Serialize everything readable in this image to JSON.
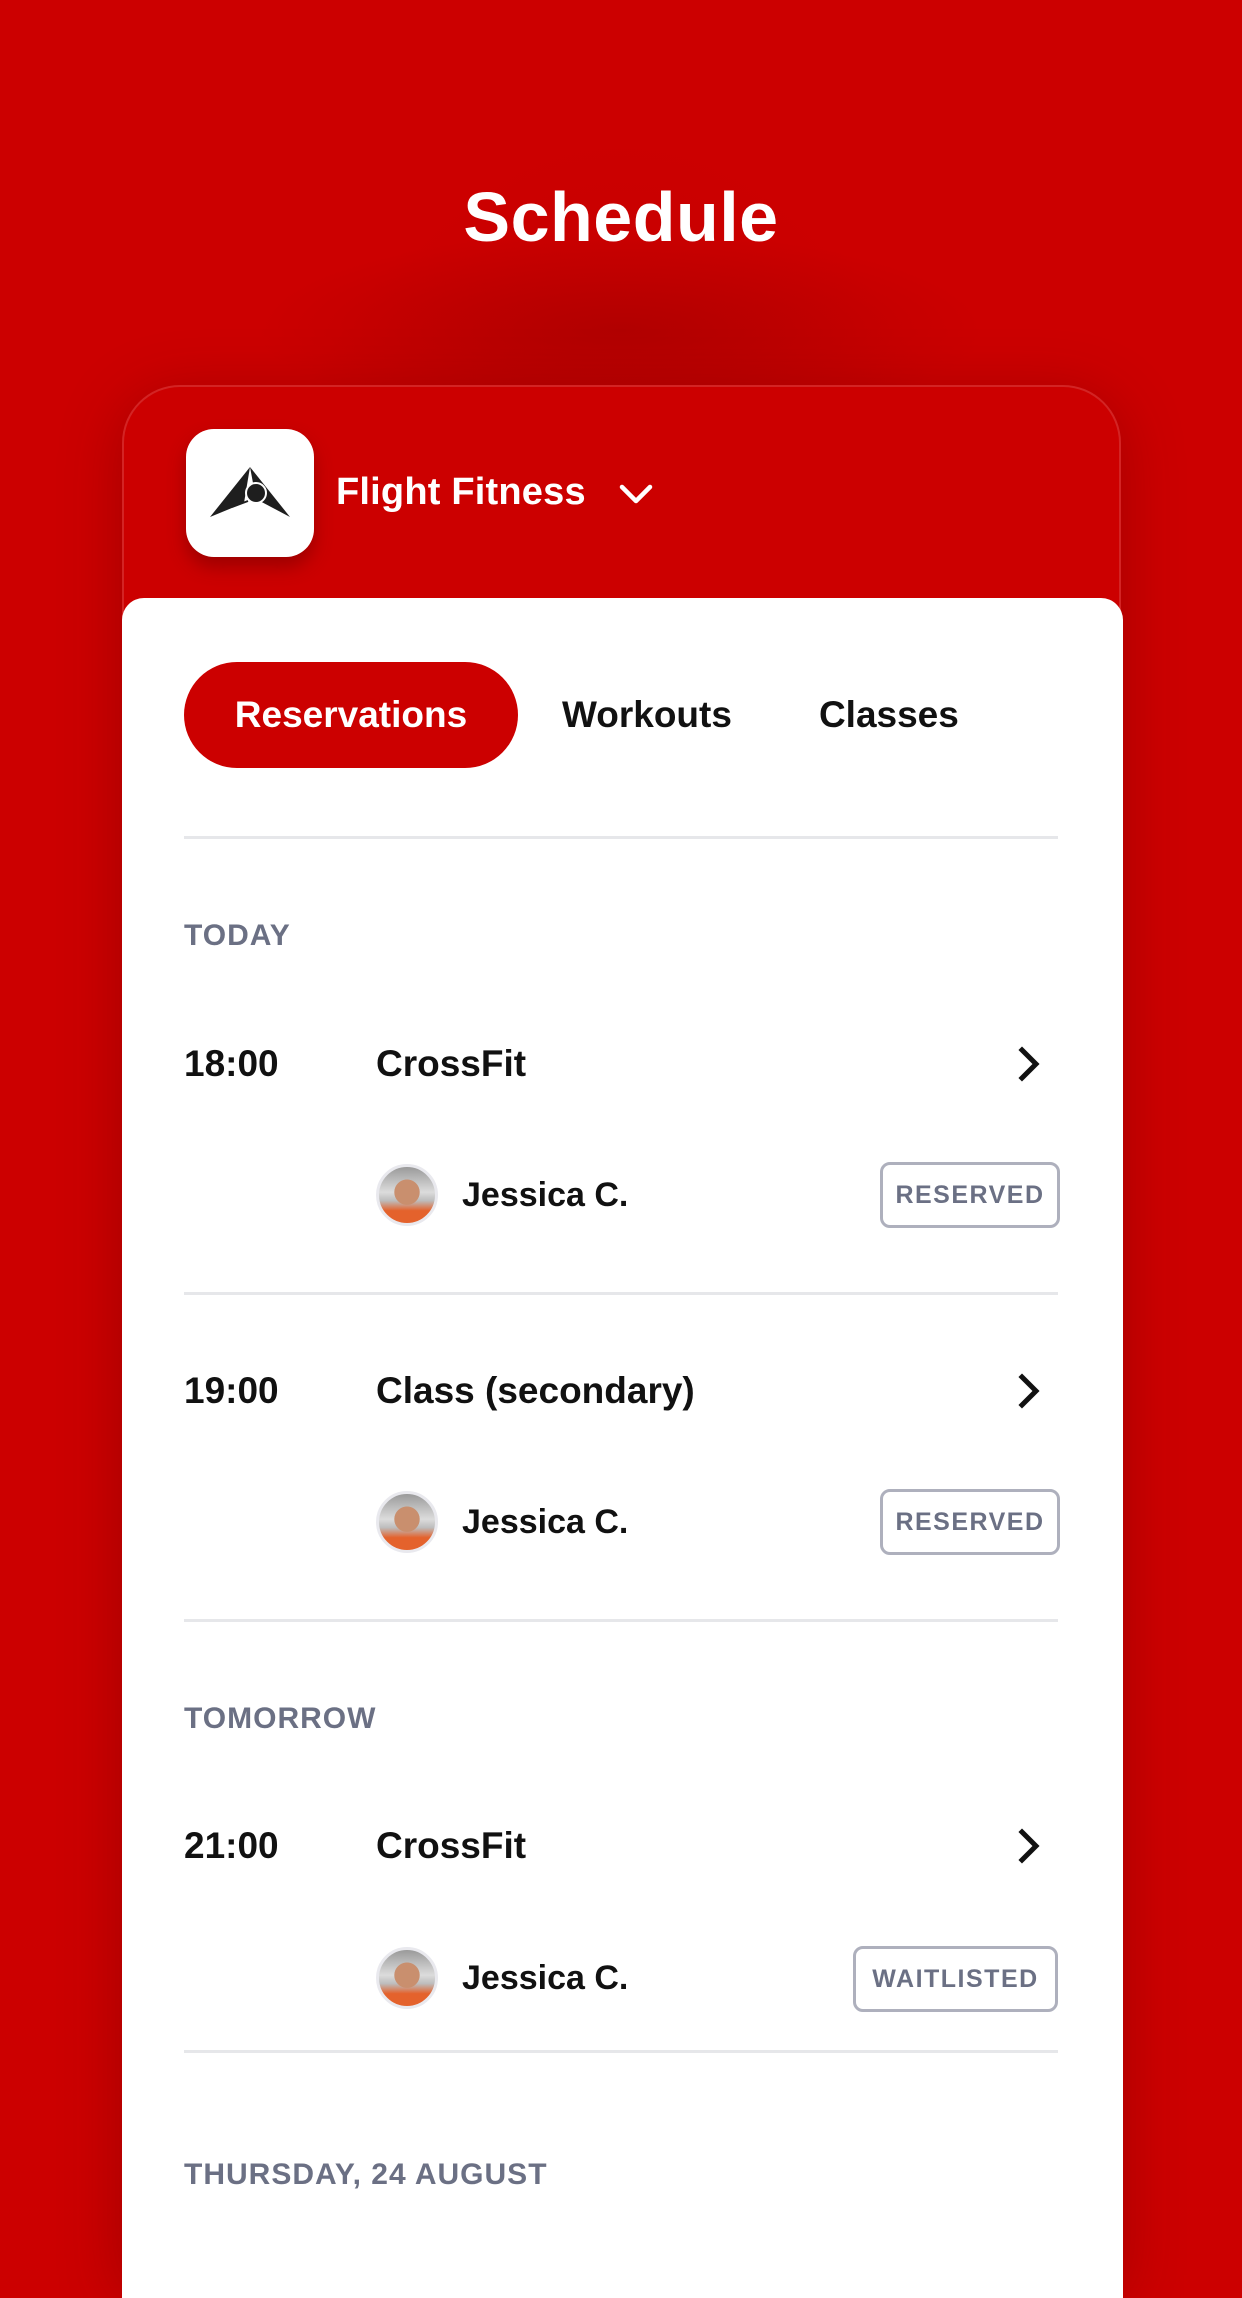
{
  "page": {
    "title": "Schedule"
  },
  "gym": {
    "name": "Flight Fitness",
    "logo_icon": "flight-fitness-logo",
    "dropdown_icon": "chevron-down-icon"
  },
  "tabs": [
    {
      "label": "Reservations",
      "active": true
    },
    {
      "label": "Workouts",
      "active": false
    },
    {
      "label": "Classes",
      "active": false
    }
  ],
  "sections": [
    {
      "label": "TODAY",
      "items": [
        {
          "time": "18:00",
          "title": "CrossFit",
          "person": "Jessica C.",
          "status": "RESERVED"
        },
        {
          "time": "19:00",
          "title": "Class (secondary)",
          "person": "Jessica C.",
          "status": "RESERVED"
        }
      ]
    },
    {
      "label": "TOMORROW",
      "items": [
        {
          "time": "21:00",
          "title": "CrossFit",
          "person": "Jessica C.",
          "status": "WAITLISTED"
        }
      ]
    },
    {
      "label": "THURSDAY, 24 AUGUST",
      "items": []
    }
  ],
  "colors": {
    "brand": "#cc0000",
    "label_gray": "#6b7084",
    "badge_border": "#aeb0bd",
    "divider": "#e6e7ea",
    "text": "#111111"
  }
}
